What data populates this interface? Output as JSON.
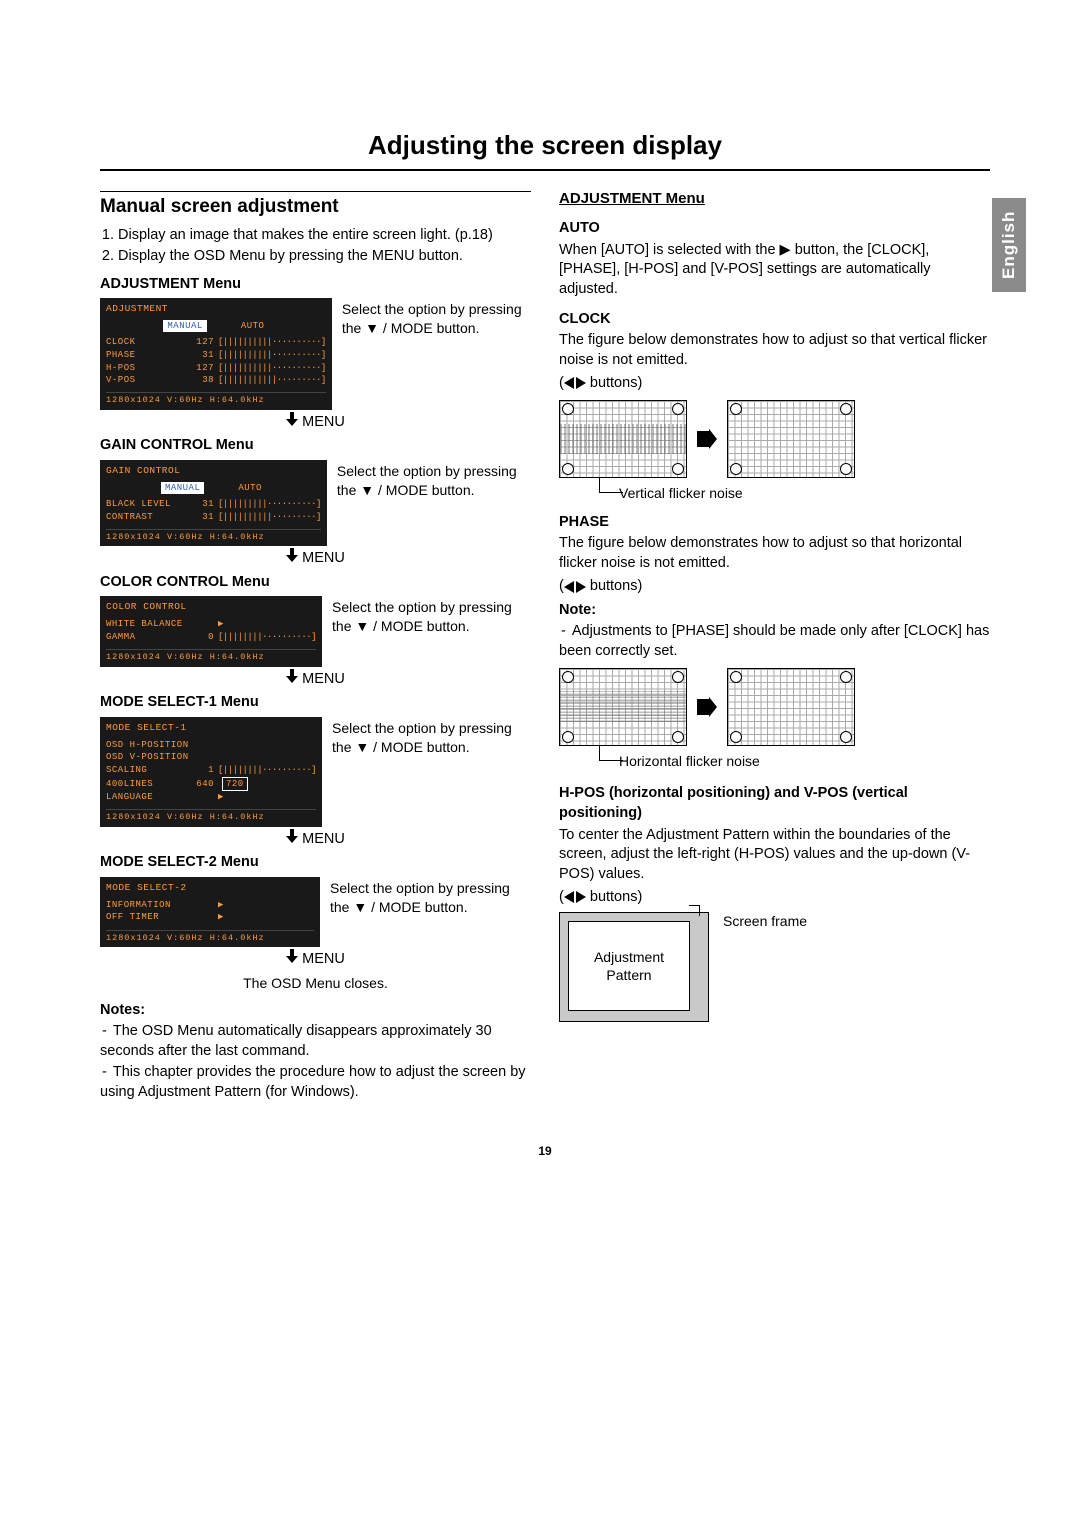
{
  "title": "Adjusting the screen display",
  "language_tab": "English",
  "page_number": "19",
  "left": {
    "section_title": "Manual screen adjustment",
    "steps": [
      "Display an image that makes the entire screen light. (p.18)",
      "Display the OSD Menu by pressing the MENU button."
    ],
    "menus": [
      {
        "label": "ADJUSTMENT Menu",
        "panel": {
          "title": "ADJUSTMENT",
          "tabs_manual": "MANUAL",
          "tabs_auto": "AUTO",
          "lines": [
            {
              "name": "CLOCK",
              "val": "127",
              "bar": "[||||||||||··········]"
            },
            {
              "name": "PHASE",
              "val": "31",
              "bar": "[||||||||||··········]"
            },
            {
              "name": "H-POS",
              "val": "127",
              "bar": "[||||||||||··········]"
            },
            {
              "name": "V-POS",
              "val": "38",
              "bar": "[|||||||||||·········]"
            }
          ],
          "status": "1280x1024   V:60Hz   H:64.0kHz"
        },
        "side": "Select the option by pressing the ▼ / MODE button.",
        "nav": "MENU"
      },
      {
        "label": "GAIN CONTROL Menu",
        "panel": {
          "title": "GAIN  CONTROL",
          "tabs_manual": "MANUAL",
          "tabs_auto": "AUTO",
          "lines": [
            {
              "name": "BLACK LEVEL",
              "val": "31",
              "bar": "[|||||||||··········]"
            },
            {
              "name": "CONTRAST",
              "val": "31",
              "bar": "[||||||||||·········]"
            }
          ],
          "status": "1280x1024   V:60Hz   H:64.0kHz"
        },
        "side": "Select the option by pressing the ▼ / MODE button.",
        "nav": "MENU"
      },
      {
        "label": "COLOR CONTROL Menu",
        "panel": {
          "title": "COLOR CONTROL",
          "lines": [
            {
              "name": "WHITE BALANCE",
              "val": "",
              "bar": "▶"
            },
            {
              "name": "GAMMA",
              "val": "0",
              "bar": "[||||||||··········]"
            }
          ],
          "status": "1280x1024   V:60Hz   H:64.0kHz"
        },
        "side": "Select the option by pressing the ▼ / MODE button.",
        "nav": "MENU"
      },
      {
        "label": "MODE SELECT-1 Menu",
        "panel": {
          "title": "MODE SELECT-1",
          "lines": [
            {
              "name": "OSD H-POSITION",
              "val": "",
              "bar": ""
            },
            {
              "name": "OSD V-POSITION",
              "val": "",
              "bar": ""
            },
            {
              "name": "SCALING",
              "val": "1",
              "bar": "[||||||||··········]"
            },
            {
              "name": "400LINES",
              "val": "640",
              "bar": "[720]"
            },
            {
              "name": "LANGUAGE",
              "val": "",
              "bar": "▶"
            }
          ],
          "status": "1280x1024   V:60Hz   H:64.0kHz"
        },
        "side": "Select the option by pressing the ▼ / MODE button.",
        "nav": "MENU"
      },
      {
        "label": "MODE SELECT-2 Menu",
        "panel": {
          "title": "MODE SELECT-2",
          "lines": [
            {
              "name": "INFORMATION",
              "val": "",
              "bar": "▶"
            },
            {
              "name": "OFF TIMER",
              "val": "",
              "bar": "▶"
            }
          ],
          "status": "1280x1024   V:60Hz   H:64.0kHz"
        },
        "side": "Select the option by pressing the ▼ / MODE button.",
        "nav": "MENU",
        "after": "The OSD Menu closes."
      }
    ],
    "notes_label": "Notes:",
    "notes": [
      "The OSD Menu automatically disappears approximately 30 seconds after the last command.",
      "This chapter provides the procedure how to adjust the screen by using Adjustment Pattern (for Windows)."
    ]
  },
  "right": {
    "heading": "ADJUSTMENT Menu",
    "auto": {
      "title": "AUTO",
      "text": "When [AUTO] is selected with the ▶ button, the [CLOCK], [PHASE], [H-POS] and [V-POS] settings are automatically adjusted."
    },
    "clock": {
      "title": "CLOCK",
      "text": "The figure below demonstrates how to adjust so that vertical flicker noise is not emitted.",
      "buttons": "buttons)",
      "caption": "Vertical flicker noise"
    },
    "phase": {
      "title": "PHASE",
      "text": "The figure below demonstrates how to adjust so that horizontal flicker noise is not emitted.",
      "buttons": "buttons)",
      "note_label": "Note:",
      "note_item": "Adjustments to [PHASE] should be made only after [CLOCK] has been correctly set.",
      "caption": "Horizontal flicker noise"
    },
    "hpos": {
      "title": "H-POS (horizontal positioning) and V-POS (vertical positioning)",
      "text": "To center the Adjustment Pattern within the boundaries of the screen, adjust the left-right (H-POS) values and the up-down (V-POS) values.",
      "buttons": "buttons)",
      "screen_frame": "Screen frame",
      "inner": "Adjustment Pattern"
    }
  }
}
